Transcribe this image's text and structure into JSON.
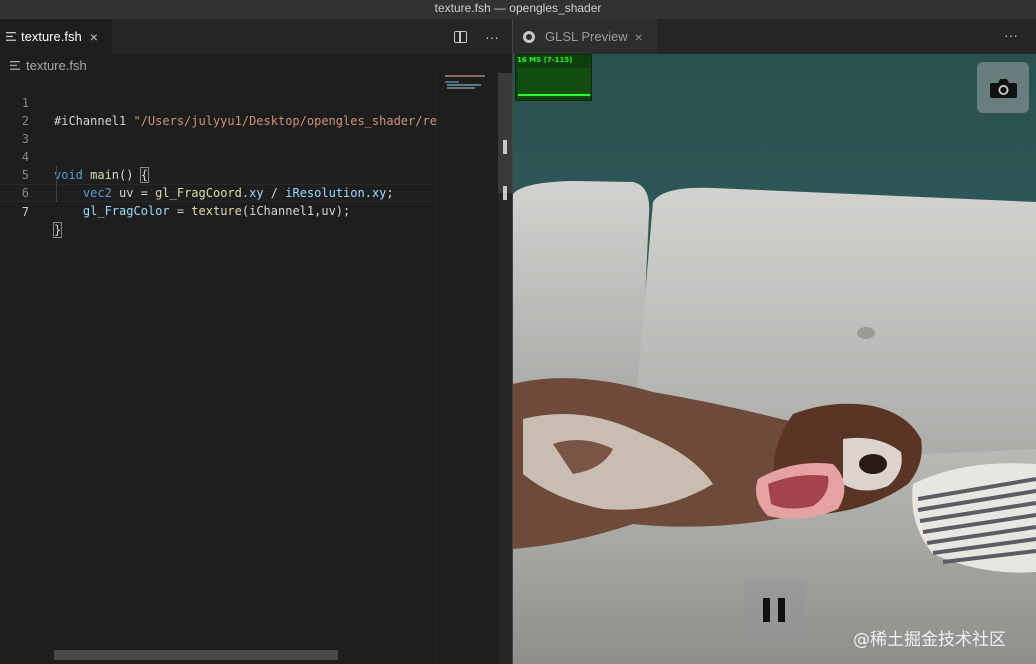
{
  "window": {
    "title": "texture.fsh — opengles_shader"
  },
  "editor": {
    "tab": {
      "label": "texture.fsh",
      "close": "×"
    },
    "actions": {
      "more": "···"
    },
    "breadcrumb": {
      "file": "texture.fsh"
    },
    "lines": [
      {
        "num": "1",
        "code": "#iChannel1 \"/Users/julyyu1/Desktop/opengles_shader/re"
      },
      {
        "num": "2",
        "code": ""
      },
      {
        "num": "3",
        "code": ""
      },
      {
        "num": "4",
        "code": "void main() {"
      },
      {
        "num": "5",
        "code": "    vec2 uv = gl_FragCoord.xy / iResolution.xy;"
      },
      {
        "num": "6",
        "code": "    gl_FragColor = texture(iChannel1,uv);"
      },
      {
        "num": "7",
        "code": "}"
      }
    ],
    "tokens": {
      "l1_directive": "#iChannel1 ",
      "l1_string": "\"/Users/julyyu1/Desktop/opengles_shader/re",
      "l4_void": "void",
      "l4_main": " main",
      "l4_rest": "() ",
      "l4_brace": "{",
      "l5_indent": "    ",
      "l5_type": "vec2",
      "l5_var": " uv ",
      "l5_eq": "= ",
      "l5_frag": "gl_FragCoord",
      "l5_xy": ".xy",
      "l5_div": " / ",
      "l5_res": "iResolution",
      "l5_xy2": ".xy",
      "l5_semi": ";",
      "l6_indent": "    ",
      "l6_var": "gl_FragColor",
      "l6_eq": " = ",
      "l6_fn": "texture",
      "l6_args": "(iChannel1,uv);",
      "l7_brace": "}"
    }
  },
  "preview": {
    "tab": {
      "label": "GLSL Preview",
      "close": "×"
    },
    "more": "···",
    "stats": {
      "label": "16 MS (7-115)"
    },
    "image": {
      "description_icon": "photo-icon"
    },
    "watermark": "@稀土掘金技术社区"
  },
  "colors": {
    "keyword": "#569cd6",
    "function": "#dcdcaa",
    "variable": "#9cdcfe",
    "string": "#ce9178",
    "stats_green": "#1cff1c"
  }
}
